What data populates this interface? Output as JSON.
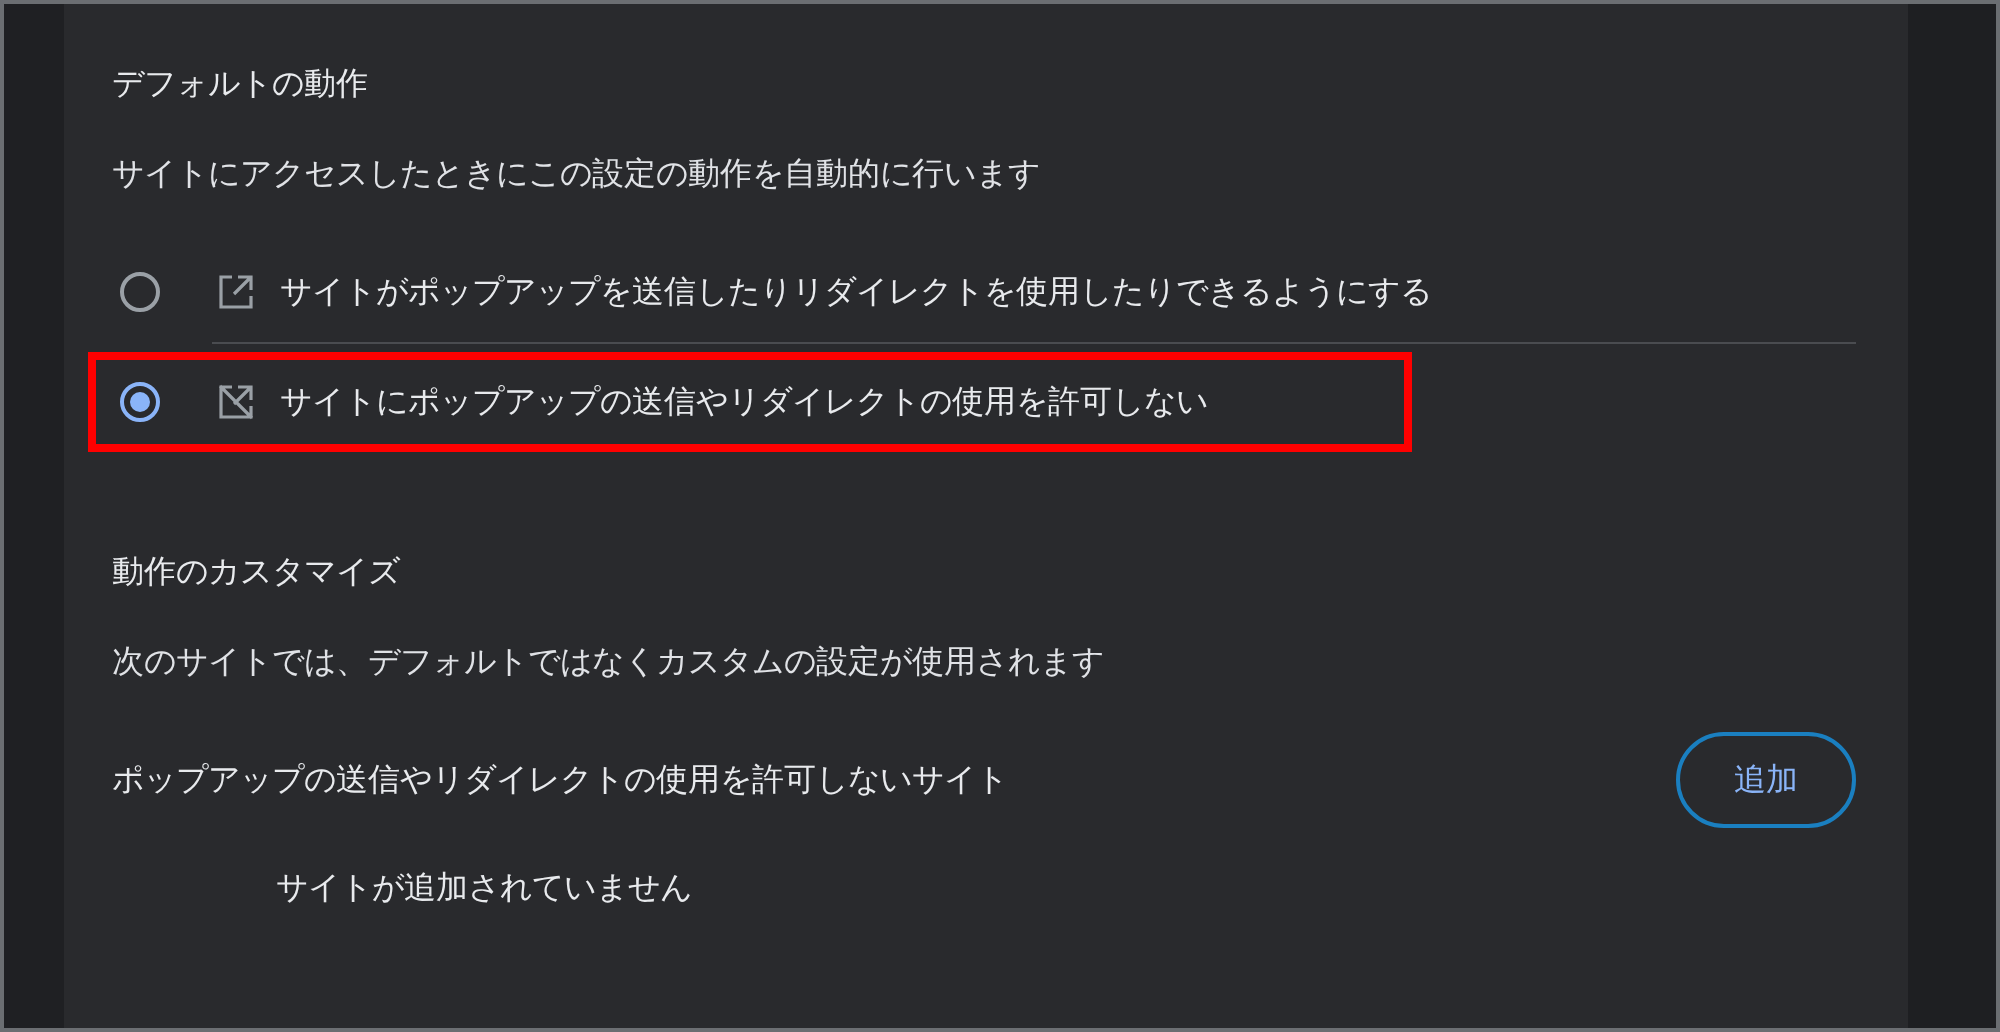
{
  "default_behavior": {
    "title": "デフォルトの動作",
    "description": "サイトにアクセスしたときにこの設定の動作を自動的に行います",
    "options": [
      {
        "kind": "allow",
        "label": "サイトがポップアップを送信したりリダイレクトを使用したりできるようにする",
        "selected": false,
        "highlighted": false
      },
      {
        "kind": "block",
        "label": "サイトにポップアップの送信やリダイレクトの使用を許可しない",
        "selected": true,
        "highlighted": true
      }
    ]
  },
  "custom_behavior": {
    "title": "動作のカスタマイズ",
    "description": "次のサイトでは、デフォルトではなくカスタムの設定が使用されます",
    "block_list": {
      "title": "ポップアップの送信やリダイレクトの使用を許可しないサイト",
      "button": "追加",
      "empty": "サイトが追加されていません"
    }
  }
}
